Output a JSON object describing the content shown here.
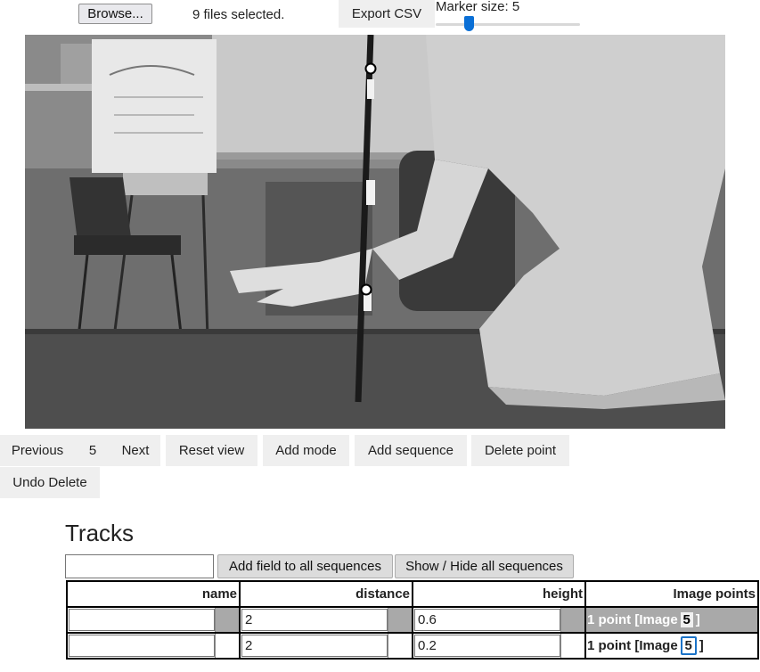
{
  "toolbar": {
    "browse_label": "Browse...",
    "files_status": "9 files selected.",
    "export_label": "Export CSV",
    "marker_size_label": "Marker size: 5",
    "marker_size_value": 5
  },
  "viewer": {
    "image_description_icon": "grayscale-photo"
  },
  "controls": {
    "previous_label": "Previous",
    "image_index": "5",
    "next_label": "Next",
    "reset_view_label": "Reset view",
    "add_mode_label": "Add mode",
    "add_sequence_label": "Add sequence",
    "delete_point_label": "Delete point",
    "undo_delete_label": "Undo Delete"
  },
  "tracks": {
    "heading": "Tracks",
    "new_field_value": "",
    "add_field_label": "Add field to all sequences",
    "show_hide_label": "Show / Hide all sequences",
    "columns": [
      "name",
      "distance",
      "height",
      "Image points"
    ],
    "rows": [
      {
        "name": "",
        "distance": "2",
        "height": "0.6",
        "points_prefix": "1 point [Image",
        "points_image": "5",
        "points_suffix": "]"
      },
      {
        "name": "",
        "distance": "2",
        "height": "0.2",
        "points_prefix": "1 point [Image",
        "points_image": "5",
        "points_suffix": "]"
      }
    ]
  },
  "colors": {
    "active_row": "#a9a9a9",
    "focus_outline": "#1a73c8",
    "slider_thumb": "#0a6fd6"
  }
}
